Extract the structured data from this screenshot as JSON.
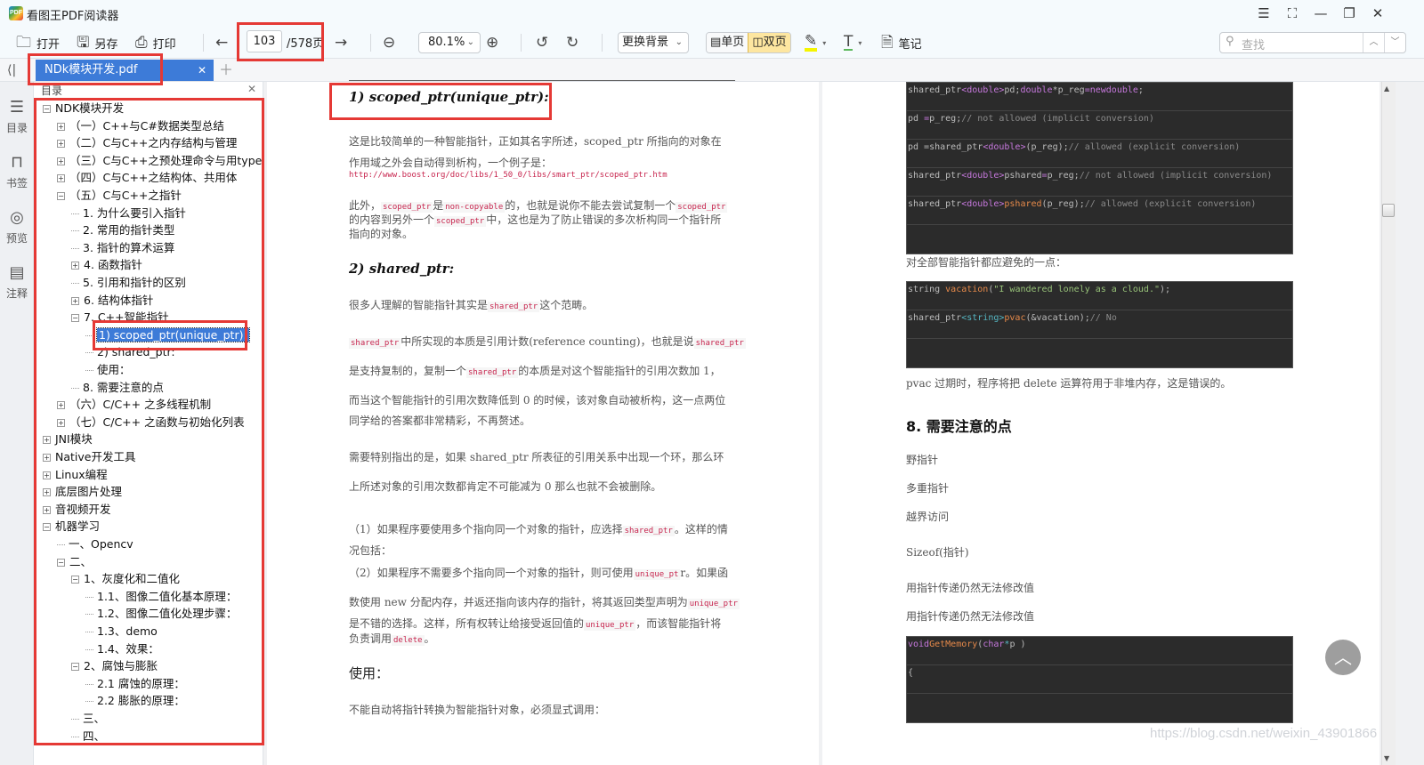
{
  "app": {
    "logo": "PDF",
    "title": "看图王PDF阅读器"
  },
  "window_controls": [
    {
      "name": "menu-icon",
      "glyph": "☰"
    },
    {
      "name": "fullscreen-icon",
      "glyph": "⛶"
    },
    {
      "name": "minimize-icon",
      "glyph": "—"
    },
    {
      "name": "restore-icon",
      "glyph": "❐"
    },
    {
      "name": "close-icon",
      "glyph": "✕"
    }
  ],
  "toolbar": {
    "open": "打开",
    "save_as": "另存",
    "print": "打印",
    "page_current": "103",
    "page_total": "/578页",
    "zoom": "80.1%",
    "background": "更换背景",
    "single_page": "单页",
    "double_page": "双页",
    "notes": "笔记",
    "search_placeholder": "查找"
  },
  "tab": {
    "label": "NDk模块开发.pdf"
  },
  "left_nav": [
    {
      "label": "目录",
      "icon": "toc-icon",
      "glyph": "☰"
    },
    {
      "label": "书签",
      "icon": "bookmark-icon",
      "glyph": "🔖"
    },
    {
      "label": "预览",
      "icon": "eye-icon",
      "glyph": "◎"
    },
    {
      "label": "注释",
      "icon": "comment-icon",
      "glyph": "▤"
    }
  ],
  "outline": {
    "title": "目录",
    "items": [
      {
        "label": "NDK模块开发",
        "level": 0,
        "state": "open"
      },
      {
        "label": "（一）C++与C#数据类型总结",
        "level": 1,
        "state": "closed"
      },
      {
        "label": "（二）C与C++之内存结构与管理",
        "level": 1,
        "state": "closed"
      },
      {
        "label": "（三）C与C++之预处理命令与用typede",
        "level": 1,
        "state": "closed"
      },
      {
        "label": "（四）C与C++之结构体、共用体",
        "level": 1,
        "state": "closed"
      },
      {
        "label": "（五）C与C++之指针",
        "level": 1,
        "state": "open"
      },
      {
        "label": "1. 为什么要引入指针",
        "level": 2,
        "state": "leaf"
      },
      {
        "label": "2. 常用的指针类型",
        "level": 2,
        "state": "leaf"
      },
      {
        "label": "3. 指针的算术运算",
        "level": 2,
        "state": "leaf"
      },
      {
        "label": "4. 函数指针",
        "level": 2,
        "state": "closed"
      },
      {
        "label": "5. 引用和指针的区别",
        "level": 2,
        "state": "leaf"
      },
      {
        "label": "6. 结构体指针",
        "level": 2,
        "state": "closed"
      },
      {
        "label": "7. C++智能指针",
        "level": 2,
        "state": "open"
      },
      {
        "label": "1) scoped_ptr(unique_ptr):",
        "level": 3,
        "state": "leaf",
        "selected": true
      },
      {
        "label": "2) shared_ptr:",
        "level": 3,
        "state": "leaf"
      },
      {
        "label": "使用：",
        "level": 3,
        "state": "leaf"
      },
      {
        "label": "8. 需要注意的点",
        "level": 2,
        "state": "leaf"
      },
      {
        "label": "（六）C/C++ 之多线程机制",
        "level": 1,
        "state": "closed"
      },
      {
        "label": "（七）C/C++ 之函数与初始化列表",
        "level": 1,
        "state": "closed"
      },
      {
        "label": "JNI模块",
        "level": 0,
        "state": "closed"
      },
      {
        "label": "Native开发工具",
        "level": 0,
        "state": "closed"
      },
      {
        "label": "Linux编程",
        "level": 0,
        "state": "closed"
      },
      {
        "label": "底层图片处理",
        "level": 0,
        "state": "closed"
      },
      {
        "label": "音视频开发",
        "level": 0,
        "state": "closed"
      },
      {
        "label": "机器学习",
        "level": 0,
        "state": "open"
      },
      {
        "label": "一、Opencv",
        "level": 1,
        "state": "leaf"
      },
      {
        "label": "二、",
        "level": 1,
        "state": "open"
      },
      {
        "label": "1、灰度化和二值化",
        "level": 2,
        "state": "open"
      },
      {
        "label": "1.1、图像二值化基本原理：",
        "level": 3,
        "state": "leaf"
      },
      {
        "label": "1.2、图像二值化处理步骤：",
        "level": 3,
        "state": "leaf"
      },
      {
        "label": "1.3、demo",
        "level": 3,
        "state": "leaf"
      },
      {
        "label": "1.4、效果：",
        "level": 3,
        "state": "leaf"
      },
      {
        "label": "2、腐蚀与膨胀",
        "level": 2,
        "state": "open"
      },
      {
        "label": "2.1 腐蚀的原理：",
        "level": 3,
        "state": "leaf"
      },
      {
        "label": "2.2 膨胀的原理：",
        "level": 3,
        "state": "leaf"
      },
      {
        "label": "三、",
        "level": 2,
        "state": "leaf"
      },
      {
        "label": "四、",
        "level": 2,
        "state": "leaf"
      }
    ]
  },
  "page_left": {
    "heading1": "1) scoped_ptr(unique_ptr):",
    "p1a": "这是比较简单的一种智能指针，正如其名字所述，scoped_ptr 所指向的对象在",
    "p1b": "作用域之外会自动得到析构，一个例子是：",
    "link": "http://www.boost.org/doc/libs/1_50_0/libs/smart_ptr/scoped_ptr.htm",
    "p2a": [
      "此外，",
      "scoped_ptr",
      "是",
      "non-copyable",
      "的，也就是说你不能去尝试复制一个",
      "scoped_ptr"
    ],
    "p2b": [
      "的内容到另外一个",
      "scoped_ptr",
      "中，这也是为了防止错误的多次析构同一个指针所"
    ],
    "p2c": "指向的对象。",
    "heading2": "2) shared_ptr:",
    "p3": [
      "很多人理解的智能指针其实是",
      "shared_ptr",
      "这个范畴。"
    ],
    "p4a": [
      "shared_ptr",
      "中所实现的本质是引用计数(reference counting)，也就是说",
      "shared_ptr"
    ],
    "p4b": [
      "是支持复制的，复制一个",
      "shared_ptr",
      "的本质是对这个智能指针的引用次数加 1，"
    ],
    "p4c": "而当这个智能指针的引用次数降低到 0 的时候，该对象自动被析构，这一点两位",
    "p4d": "同学给的答案都非常精彩，不再赘述。",
    "p5a": "需要特别指出的是，如果 shared_ptr 所表征的引用关系中出现一个环，那么环",
    "p5b": "上所述对象的引用次数都肯定不可能减为 0 那么也就不会被删除。",
    "p6a": [
      "（1）如果程序要使用多个指向同一个对象的指针，应选择",
      "shared_ptr",
      "。这样的情"
    ],
    "p6b": "况包括：",
    "p7a": [
      "（2）如果程序不需要多个指向同一个对象的指针，则可使用",
      "unique_pt",
      "r。如果函"
    ],
    "p7b": [
      "数使用 new 分配内存，并返还指向该内存的指针，将其返回类型声明为",
      "unique_ptr"
    ],
    "p7c": [
      "是不错的选择。这样，所有权转让给接受返回值的",
      "unique_ptr",
      "，而该智能指针将"
    ],
    "p7d": [
      "负责调用",
      "delete",
      "。"
    ],
    "heading3": "使用：",
    "p8": "不能自动将指针转换为智能指针对象，必须显式调用："
  },
  "page_right": {
    "code1": [
      [
        [
          "",
          "shared_ptr"
        ],
        [
          "kw",
          "<double>"
        ],
        [
          "",
          "pd;"
        ],
        [
          "kw",
          "double"
        ],
        [
          "",
          "*p_reg"
        ],
        [
          "kw",
          "=newdouble"
        ],
        [
          "",
          ";"
        ]
      ],
      [
        [
          "",
          "pd "
        ],
        [
          "kw",
          "="
        ],
        [
          "",
          "p_reg;"
        ],
        [
          "cm",
          "// not allowed (implicit conversion)"
        ]
      ],
      [
        [
          "",
          "pd ="
        ],
        [
          "",
          "shared_ptr"
        ],
        [
          "kw",
          "<double>"
        ],
        [
          "",
          "(p_reg);"
        ],
        [
          "cm",
          "// allowed (explicit conversion)"
        ]
      ],
      [
        [
          "",
          "shared_ptr"
        ],
        [
          "kw",
          "<double>"
        ],
        [
          "",
          "pshared"
        ],
        [
          "kw",
          "="
        ],
        [
          "",
          "p_reg;"
        ],
        [
          "cm",
          "// not allowed (implicit conversion)"
        ]
      ],
      [
        [
          "",
          "shared_ptr"
        ],
        [
          "kw",
          "<double>"
        ],
        [
          "fn",
          "pshared"
        ],
        [
          "",
          "(p_reg);"
        ],
        [
          "cm",
          "// allowed (explicit conversion)"
        ]
      ],
      []
    ],
    "t1": "对全部智能指针都应避免的一点：",
    "code2": [
      [
        [
          "",
          "string "
        ],
        [
          "fn",
          "vacation"
        ],
        [
          "",
          "("
        ],
        [
          "str",
          "\"I wandered lonely as a cloud.\""
        ],
        [
          "",
          ");"
        ]
      ],
      [
        [
          "",
          "shared_ptr"
        ],
        [
          "cy",
          "<string>"
        ],
        [
          "fn",
          "pvac"
        ],
        [
          "",
          "(&vacation);"
        ],
        [
          "cm",
          "// No"
        ]
      ],
      []
    ],
    "t2": "pvac 过期时，程序将把 delete 运算符用于非堆内存，这是错误的。",
    "heading": "8. 需要注意的点",
    "items": [
      "野指针",
      "多重指针",
      "越界访问",
      "Sizeof(指针)",
      "用指针传递仍然无法修改值",
      "用指针传递仍然无法修改值"
    ],
    "code3": [
      [
        [
          "kw",
          "void"
        ],
        [
          "fn",
          "GetMemory"
        ],
        [
          "",
          "("
        ],
        [
          "kw",
          "char"
        ],
        [
          "cy",
          "*"
        ],
        [
          "",
          "p )"
        ]
      ],
      [
        [
          "",
          "{"
        ]
      ],
      []
    ]
  },
  "watermark": "https://blog.csdn.net/weixin_43901866",
  "colors": {
    "accent": "#3d7bd8",
    "highlight_box": "#e53935",
    "active_view": "#fde6a0"
  }
}
